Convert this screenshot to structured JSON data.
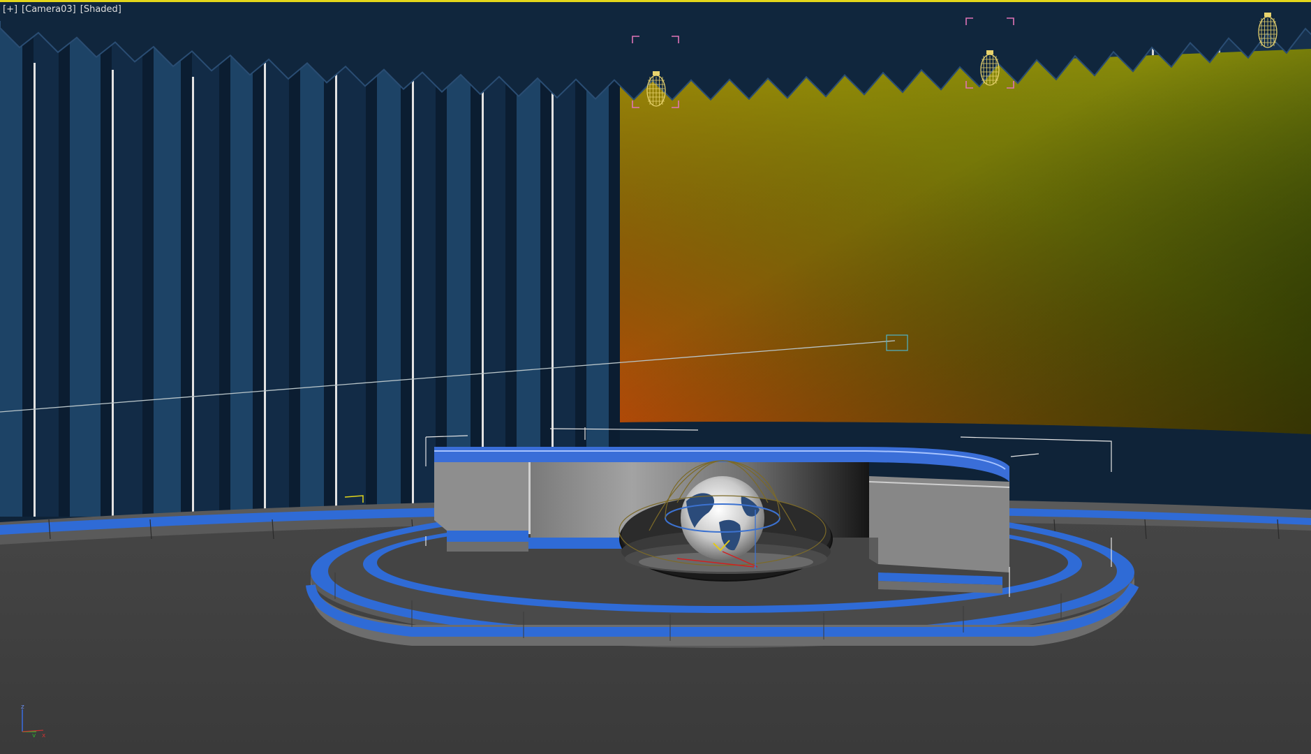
{
  "viewport": {
    "labels": {
      "menu": "[+]",
      "camera": "[Camera03]",
      "shading": "[Shaded]"
    },
    "active_border_color": "#e3d61a",
    "background_color": "#3c3c3c",
    "axis_tripod": {
      "z_label": "z",
      "y_label": "y",
      "x_label": "x",
      "colors": {
        "x": "#c83232",
        "y": "#2fb52f",
        "z": "#3a6ad8"
      }
    }
  },
  "scene": {
    "description_icons": [
      "camera-target-icon",
      "spotlight-icon",
      "globe-icon",
      "light-bracket-icon"
    ],
    "colors": {
      "curtain_dark": "#0e2236",
      "curtain_mid": "#1a3a59",
      "curtain_light": "#2a4f73",
      "floor": "#3c3c3c",
      "accent_blue": "#2f6bd6",
      "desk_gray": "#8c8c8c",
      "screen_orange": "#c8520b",
      "screen_yellow": "#b0a20d",
      "screen_green": "#2c5c0a",
      "light_wire": "#e8d36e",
      "selection_bracket": "#e074b7"
    }
  }
}
